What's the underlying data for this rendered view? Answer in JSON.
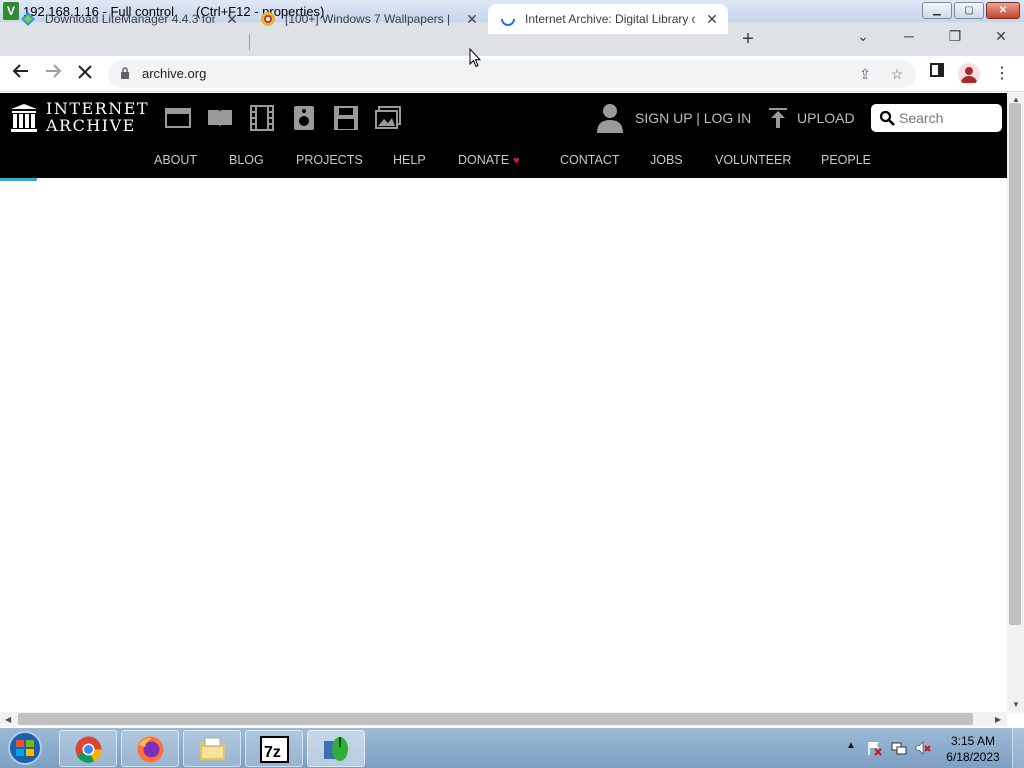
{
  "remote": {
    "title": "192.168.1.16  - Full control",
    "hint": "(Ctrl+F12 - properties)"
  },
  "tabs": [
    {
      "label": "Download LiteManager 4.4.3 for",
      "favicon": "litemanager-icon",
      "active": false
    },
    {
      "label": "[100+] Windows 7 Wallpapers |",
      "favicon": "wallpaper-site-icon",
      "active": false
    },
    {
      "label": "Internet Archive: Digital Library o",
      "favicon": "loading-spinner-icon",
      "active": true
    }
  ],
  "address": {
    "url": "archive.org"
  },
  "ia": {
    "logo_line1": "INTERNET",
    "logo_line2": "ARCHIVE",
    "signup": "SIGN UP | LOG IN",
    "upload": "UPLOAD",
    "search_placeholder": "Search",
    "nav": [
      "ABOUT",
      "BLOG",
      "PROJECTS",
      "HELP",
      "DONATE",
      "CONTACT",
      "JOBS",
      "VOLUNTEER",
      "PEOPLE"
    ]
  },
  "taskbar": {
    "apps": [
      "chrome-icon",
      "firefox-icon",
      "file-explorer-icon",
      "7zip-icon",
      "litemanager-icon"
    ],
    "time": "3:15 AM",
    "date": "6/18/2023"
  },
  "colors": {
    "ia_black": "#000000",
    "heart_red": "#e0143c",
    "load_bar": "#23b2d3",
    "tab_strip": "#dee1e6"
  }
}
